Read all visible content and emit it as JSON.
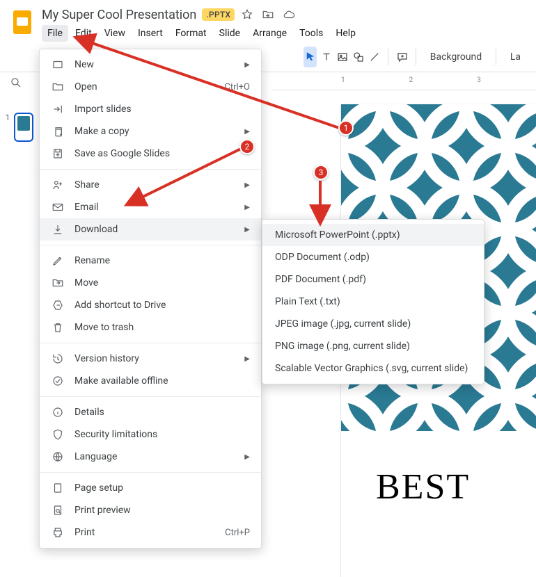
{
  "header": {
    "title": "My Super Cool Presentation",
    "badge": ".PPTX"
  },
  "menubar": [
    "File",
    "Edit",
    "View",
    "Insert",
    "Format",
    "Slide",
    "Arrange",
    "Tools",
    "Help"
  ],
  "toolbar": {
    "background_label": "Background",
    "layout_label": "La"
  },
  "ruler": [
    "1",
    "2",
    "3"
  ],
  "slide": {
    "number": "1",
    "heading": "BEST"
  },
  "file_menu": {
    "new": {
      "label": "New",
      "shortcut": "",
      "submenu": true
    },
    "open": {
      "label": "Open",
      "shortcut": "Ctrl+O",
      "submenu": false
    },
    "import": {
      "label": "Import slides",
      "shortcut": "",
      "submenu": false
    },
    "copy": {
      "label": "Make a copy",
      "shortcut": "",
      "submenu": true
    },
    "save_gs": {
      "label": "Save as Google Slides",
      "shortcut": "",
      "submenu": false
    },
    "share": {
      "label": "Share",
      "shortcut": "",
      "submenu": true
    },
    "email": {
      "label": "Email",
      "shortcut": "",
      "submenu": true
    },
    "download": {
      "label": "Download",
      "shortcut": "",
      "submenu": true
    },
    "rename": {
      "label": "Rename",
      "shortcut": "",
      "submenu": false
    },
    "move": {
      "label": "Move",
      "shortcut": "",
      "submenu": false
    },
    "add_shortcut": {
      "label": "Add shortcut to Drive",
      "shortcut": "",
      "submenu": false
    },
    "trash": {
      "label": "Move to trash",
      "shortcut": "",
      "submenu": false
    },
    "version": {
      "label": "Version history",
      "shortcut": "",
      "submenu": true
    },
    "offline": {
      "label": "Make available offline",
      "shortcut": "",
      "submenu": false
    },
    "details": {
      "label": "Details",
      "shortcut": "",
      "submenu": false
    },
    "security": {
      "label": "Security limitations",
      "shortcut": "",
      "submenu": false
    },
    "language": {
      "label": "Language",
      "shortcut": "",
      "submenu": true
    },
    "page_setup": {
      "label": "Page setup",
      "shortcut": "",
      "submenu": false
    },
    "print_preview": {
      "label": "Print preview",
      "shortcut": "",
      "submenu": false
    },
    "print": {
      "label": "Print",
      "shortcut": "Ctrl+P",
      "submenu": false
    }
  },
  "download_menu": [
    "Microsoft PowerPoint (.pptx)",
    "ODP Document (.odp)",
    "PDF Document (.pdf)",
    "Plain Text (.txt)",
    "JPEG image (.jpg, current slide)",
    "PNG image (.png, current slide)",
    "Scalable Vector Graphics (.svg, current slide)"
  ],
  "annotations": {
    "one": "1",
    "two": "2",
    "three": "3"
  }
}
